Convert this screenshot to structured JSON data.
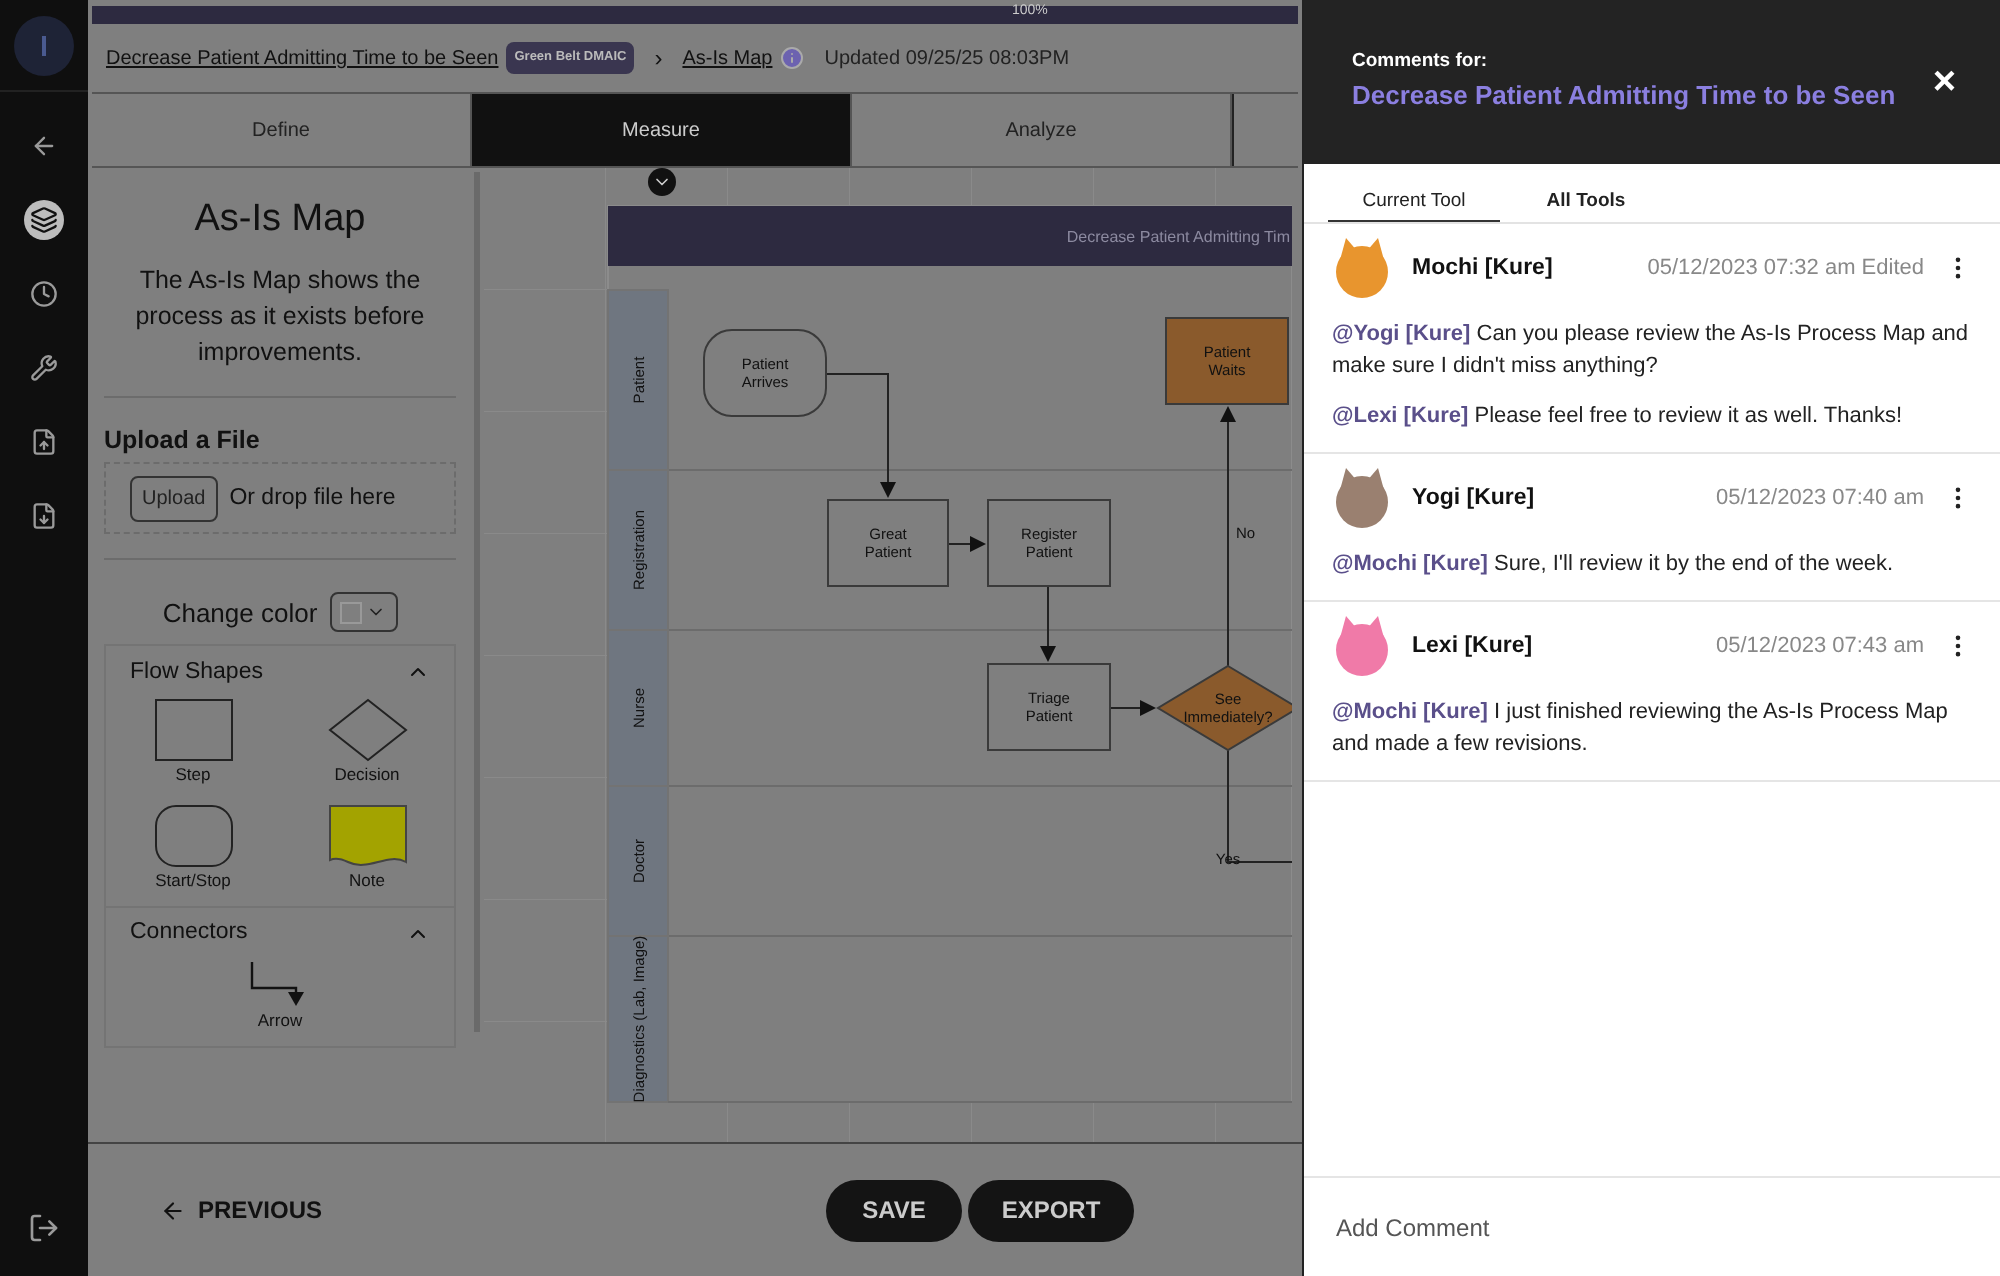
{
  "nav_items": [
    {
      "selected": false
    },
    {
      "selected": true
    },
    {
      "selected": false
    },
    {
      "selected": false
    },
    {
      "selected": false
    },
    {
      "selected": false
    },
    {
      "selected": false
    }
  ],
  "progress": {
    "label": "100%",
    "level": 1
  },
  "breadcrumb": {
    "project": "Decrease Patient Admitting Time to be Seen",
    "badge": "Green Belt DMAIC",
    "separator": "›",
    "tool": "As-Is Map",
    "updated": "Updated 09/25/25 08:03PM"
  },
  "tabs": [
    {
      "label": "Define",
      "selected": false
    },
    {
      "label": "Measure",
      "selected": true
    },
    {
      "label": "Analyze",
      "selected": false
    }
  ],
  "panel": {
    "title": "As-Is Map",
    "description": "The As-Is Map shows the process as it exists before improvements.",
    "upload": {
      "heading": "Upload a File",
      "button": "Upload",
      "hint": "Or drop file here"
    },
    "change_color": "Change color",
    "sections": [
      {
        "title": "Flow Shapes",
        "expanded": true,
        "items": [
          {
            "kind": "step",
            "label": "Step"
          },
          {
            "kind": "decision",
            "label": "Decision"
          },
          {
            "kind": "startstop",
            "label": "Start/Stop"
          },
          {
            "kind": "note",
            "label": "Note"
          }
        ]
      },
      {
        "title": "Connectors",
        "expanded": true,
        "items": [
          {
            "kind": "arrow",
            "label": "Arrow"
          }
        ]
      }
    ]
  },
  "diagram": {
    "header": "Decrease Patient Admitting Tim",
    "lanes": [
      "Patient",
      "Registration",
      "Nurse",
      "Doctor",
      "Diagnostics (Lab, Image)"
    ],
    "nodes": [
      {
        "kind": "startstop",
        "label": "Patient Arrives"
      },
      {
        "kind": "step",
        "label": "Patient Waits",
        "color": "#8a5a2c"
      },
      {
        "kind": "step",
        "label": "Great Patient"
      },
      {
        "kind": "step",
        "label": "Register Patient"
      },
      {
        "kind": "step",
        "label": "Triage Patient"
      },
      {
        "kind": "decision",
        "label": "See Immediately?"
      }
    ],
    "edge_labels": [
      "No",
      "Yes"
    ]
  },
  "footer": {
    "previous": "PREVIOUS",
    "save": "SAVE",
    "export": "EXPORT"
  },
  "comments": {
    "heading": "Comments for:",
    "title": "Decrease Patient Admitting Time to be Seen",
    "close": "×",
    "tabs": [
      {
        "label": "Current Tool",
        "selected": true
      },
      {
        "label": "All Tools",
        "selected": false
      }
    ],
    "items": [
      {
        "author": "Mochi [Kure]",
        "time": "05/12/2023 07:32 am Edited",
        "color": "#e8952e",
        "paragraphs": [
          {
            "mention": "@Yogi [Kure]",
            "text": "Can you please review the As-Is Process Map and make sure I didn't miss anything?"
          },
          {
            "mention": "@Lexi [Kure]",
            "text": "Please feel free to review it as well. Thanks!"
          }
        ]
      },
      {
        "author": "Yogi [Kure]",
        "time": "05/12/2023 07:40 am",
        "color": "#9a8070",
        "paragraphs": [
          {
            "mention": "@Mochi [Kure]",
            "text": "Sure, I'll review it by the end of the week."
          }
        ]
      },
      {
        "author": "Lexi [Kure]",
        "time": "05/12/2023 07:43 am",
        "color": "#f07aa8",
        "paragraphs": [
          {
            "mention": "@Mochi [Kure]",
            "text": "I just finished reviewing the As-Is Process Map and made a few revisions."
          }
        ]
      }
    ],
    "placeholder": "Add Comment"
  }
}
